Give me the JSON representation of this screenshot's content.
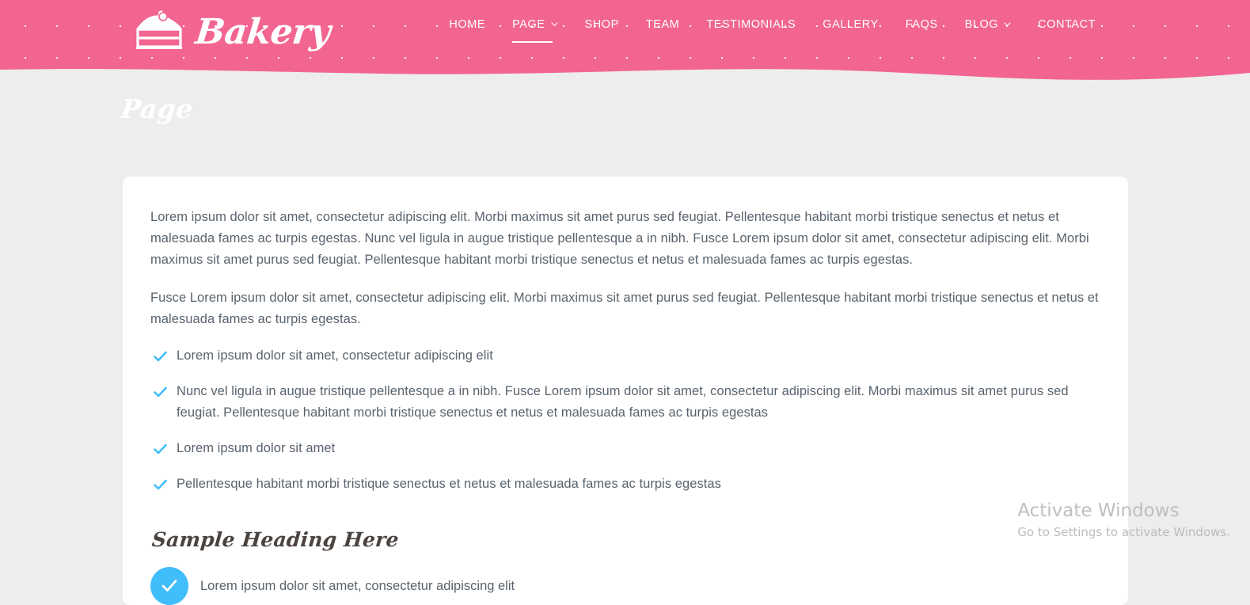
{
  "theme": {
    "pink": "#f26591",
    "blue": "#40bdfb",
    "page_bg": "#ededed",
    "card_bg": "#ffffff",
    "body_text": "#59636d",
    "heading_text": "#4b4340"
  },
  "header": {
    "logo_text": "Bakery",
    "logo_icon": "cake-slice-icon",
    "nav": [
      {
        "label": "HOME",
        "active": false,
        "dropdown": false
      },
      {
        "label": "PAGE",
        "active": true,
        "dropdown": true
      },
      {
        "label": "SHOP",
        "active": false,
        "dropdown": false
      },
      {
        "label": "TEAM",
        "active": false,
        "dropdown": false
      },
      {
        "label": "TESTIMONIALS",
        "active": false,
        "dropdown": false
      },
      {
        "label": "GALLERY",
        "active": false,
        "dropdown": false
      },
      {
        "label": "FAQS",
        "active": false,
        "dropdown": false
      },
      {
        "label": "BLOG",
        "active": false,
        "dropdown": true
      },
      {
        "label": "CONTACT",
        "active": false,
        "dropdown": false
      }
    ]
  },
  "banner": {
    "title": "Page"
  },
  "content": {
    "paragraph_1": "Lorem ipsum dolor sit amet, consectetur adipiscing elit. Morbi maximus sit amet purus sed feugiat. Pellentesque habitant morbi tristique senectus et netus et malesuada fames ac turpis egestas. Nunc vel ligula in augue tristique pellentesque a in nibh. Fusce Lorem ipsum dolor sit amet, consectetur adipiscing elit. Morbi maximus sit amet purus sed feugiat. Pellentesque habitant morbi tristique senectus et netus et malesuada fames ac turpis egestas.",
    "paragraph_2": "Fusce Lorem ipsum dolor sit amet, consectetur adipiscing elit. Morbi maximus sit amet purus sed feugiat. Pellentesque habitant morbi tristique senectus et netus et malesuada fames ac turpis egestas.",
    "check_list": [
      "Lorem ipsum dolor sit amet, consectetur adipiscing elit",
      "Nunc vel ligula in augue tristique pellentesque a in nibh. Fusce Lorem ipsum dolor sit amet, consectetur adipiscing elit. Morbi maximus sit amet purus sed feugiat. Pellentesque habitant morbi tristique senectus et netus et malesuada fames ac turpis egestas",
      "Lorem ipsum dolor sit amet",
      "Pellentesque habitant morbi tristique senectus et netus et malesuada fames ac turpis egestas"
    ],
    "sample_heading": "Sample Heading Here",
    "feature_text": "Lorem ipsum dolor sit amet, consectetur adipiscing elit"
  },
  "watermark": {
    "title": "Activate Windows",
    "subtitle": "Go to Settings to activate Windows."
  }
}
